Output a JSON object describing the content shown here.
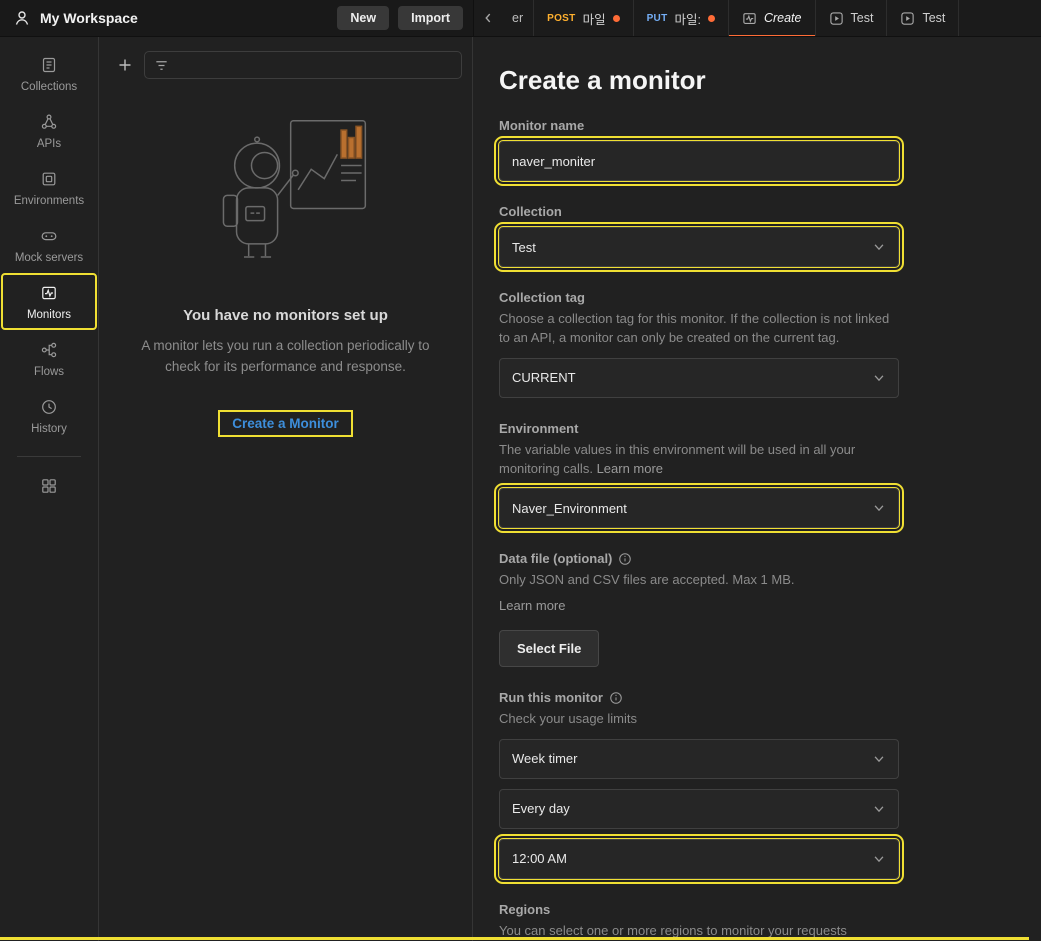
{
  "colors": {
    "highlight_yellow": "#f0df33",
    "accent_orange": "#ff6c37",
    "link_blue": "#3d8edb",
    "post_method": "#ffb02e",
    "put_method": "#74aef6"
  },
  "header": {
    "workspace": "My Workspace",
    "new_button": "New",
    "import_button": "Import"
  },
  "tabs": {
    "partial_label": "er",
    "items": [
      {
        "method": "POST",
        "title": "마일"
      },
      {
        "method": "PUT",
        "title": "마일:"
      },
      {
        "title": "Create"
      },
      {
        "title": "Test"
      },
      {
        "title": "Test"
      }
    ]
  },
  "sidebar": {
    "items": [
      {
        "label": "Collections"
      },
      {
        "label": "APIs"
      },
      {
        "label": "Environments"
      },
      {
        "label": "Mock servers"
      },
      {
        "label": "Monitors"
      },
      {
        "label": "Flows"
      },
      {
        "label": "History"
      }
    ]
  },
  "monitors_panel": {
    "empty_title": "You have no monitors set up",
    "empty_description": "A monitor lets you run a collection periodically to check for its performance and response.",
    "create_link": "Create a Monitor"
  },
  "form": {
    "title": "Create a monitor",
    "monitor_name": {
      "label": "Monitor name",
      "value": "naver_moniter"
    },
    "collection": {
      "label": "Collection",
      "value": "Test"
    },
    "collection_tag": {
      "label": "Collection tag",
      "description": "Choose a collection tag for this monitor. If the collection is not linked to an API, a monitor can only be created on the current tag.",
      "value": "CURRENT"
    },
    "environment": {
      "label": "Environment",
      "description": "The variable values in this environment will be used in all your monitoring calls.",
      "learn_more": "Learn more",
      "value": "Naver_Environment"
    },
    "data_file": {
      "label": "Data file (optional)",
      "description": "Only JSON and CSV files are accepted. Max 1 MB.",
      "learn_more": "Learn more",
      "button": "Select File"
    },
    "run_monitor": {
      "label": "Run this monitor",
      "description": "Check your usage limits",
      "timer_value": "Week timer",
      "day_value": "Every day",
      "time_value": "12:00 AM"
    },
    "regions": {
      "label": "Regions",
      "description": "You can select one or more regions to monitor your requests"
    }
  }
}
